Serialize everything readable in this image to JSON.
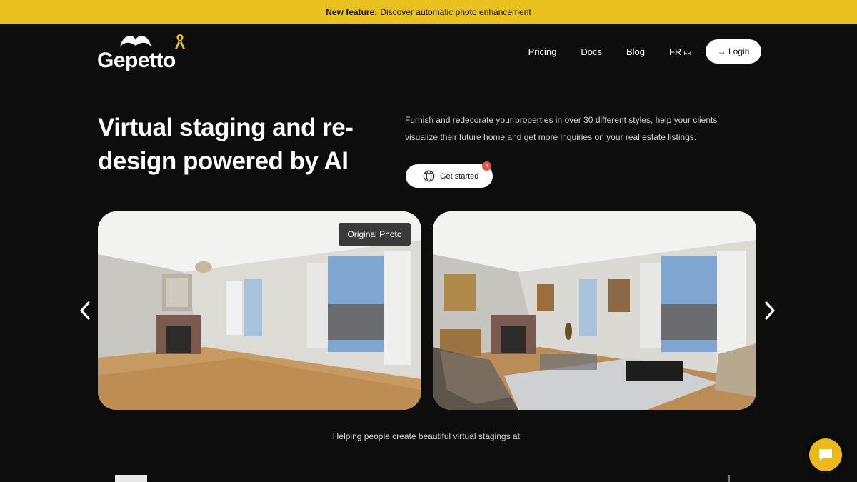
{
  "banner": {
    "label": "New feature:",
    "text": "Discover automatic photo enhancement"
  },
  "logo": {
    "text": "Gepetto"
  },
  "nav": {
    "items": [
      {
        "label": "Pricing"
      },
      {
        "label": "Docs"
      },
      {
        "label": "Blog"
      }
    ],
    "lang": {
      "label": "FR",
      "sub": "FR"
    },
    "login_label": "→ Login"
  },
  "hero": {
    "title": "Virtual staging and re-design powered by AI",
    "description": "Furnish and redecorate your properties in over 30 different styles, help your clients visualize their future home and get more inquiries on your real estate listings.",
    "cta_label": "Get started",
    "cta_badge": "4"
  },
  "carousel": {
    "badge": "Original Photo"
  },
  "tagline": "Helping people create beautiful virtual stagings at:",
  "colors": {
    "accent": "#e9c21f",
    "background": "#0d0d0d",
    "chat": "#e9b91d"
  },
  "icons": [
    "mustache-icon",
    "ribbon-icon",
    "globe-icon",
    "chevron-left-icon",
    "chevron-right-icon",
    "chat-icon"
  ]
}
